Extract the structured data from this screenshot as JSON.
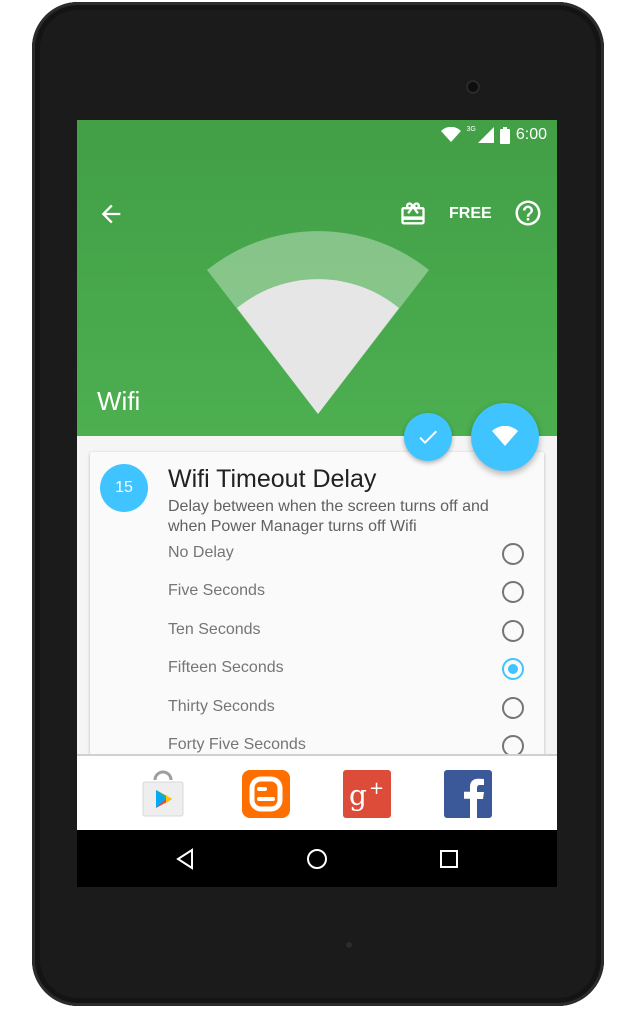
{
  "status_bar": {
    "time": "6:00",
    "network": "3G",
    "icons": [
      "wifi-icon",
      "signal-icon",
      "battery-icon"
    ]
  },
  "toolbar": {
    "back_icon": "arrow-back-icon",
    "gift_icon": "gift-icon",
    "free_label": "FREE",
    "help_icon": "help-circle-icon"
  },
  "hero": {
    "title": "Wifi",
    "icon": "wifi-large-icon"
  },
  "fabs": {
    "confirm_icon": "check-icon",
    "wifi_icon": "wifi-icon"
  },
  "card": {
    "badge": "15",
    "title": "Wifi Timeout Delay",
    "description": "Delay between when the screen turns off and when Power Manager turns off Wifi",
    "options": [
      {
        "label": "No Delay",
        "selected": false
      },
      {
        "label": "Five Seconds",
        "selected": false
      },
      {
        "label": "Ten Seconds",
        "selected": false
      },
      {
        "label": "Fifteen Seconds",
        "selected": true
      },
      {
        "label": "Thirty Seconds",
        "selected": false
      },
      {
        "label": "Forty Five Seconds",
        "selected": false
      }
    ]
  },
  "app_bar": {
    "apps": [
      "play-store-icon",
      "blogger-icon",
      "google-plus-icon",
      "facebook-icon"
    ]
  },
  "nav_bar": {
    "buttons": [
      "back-nav-icon",
      "home-nav-icon",
      "recents-nav-icon"
    ]
  },
  "colors": {
    "header_green": "#4caf50",
    "accent_blue": "#40c4ff",
    "nav_black": "#000000"
  }
}
